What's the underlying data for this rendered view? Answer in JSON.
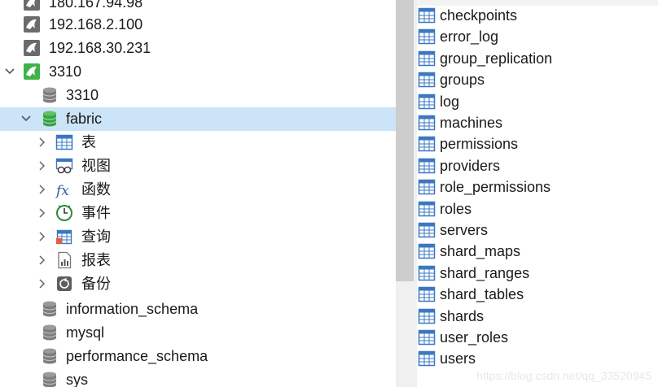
{
  "connections": [
    {
      "label": "180.167.94.98"
    },
    {
      "label": "192.168.2.100"
    },
    {
      "label": "192.168.30.231"
    },
    {
      "label": "3310"
    }
  ],
  "databases_above": [
    {
      "label": "3310"
    },
    {
      "label": "fabric"
    }
  ],
  "fabric_children": [
    {
      "label": "表",
      "icon": "table-grid-icon"
    },
    {
      "label": "视图",
      "icon": "view-glasses-icon"
    },
    {
      "label": "函数",
      "icon": "function-fx-icon"
    },
    {
      "label": "事件",
      "icon": "event-clock-icon"
    },
    {
      "label": "查询",
      "icon": "query-grid-icon"
    },
    {
      "label": "报表",
      "icon": "report-doc-icon"
    },
    {
      "label": "备份",
      "icon": "backup-icon"
    }
  ],
  "databases_below": [
    {
      "label": "information_schema"
    },
    {
      "label": "mysql"
    },
    {
      "label": "performance_schema"
    },
    {
      "label": "sys"
    }
  ],
  "tables": [
    "checkpoints",
    "error_log",
    "group_replication",
    "groups",
    "log",
    "machines",
    "permissions",
    "providers",
    "role_permissions",
    "roles",
    "servers",
    "shard_maps",
    "shard_ranges",
    "shard_tables",
    "shards",
    "user_roles",
    "users"
  ],
  "watermark": "https://blog.csdn.net/qq_33520945",
  "colors": {
    "selected_row": "#cce4f7",
    "db_icon_gray": "#8a8a8a",
    "db_icon_green": "#3aa34a"
  }
}
